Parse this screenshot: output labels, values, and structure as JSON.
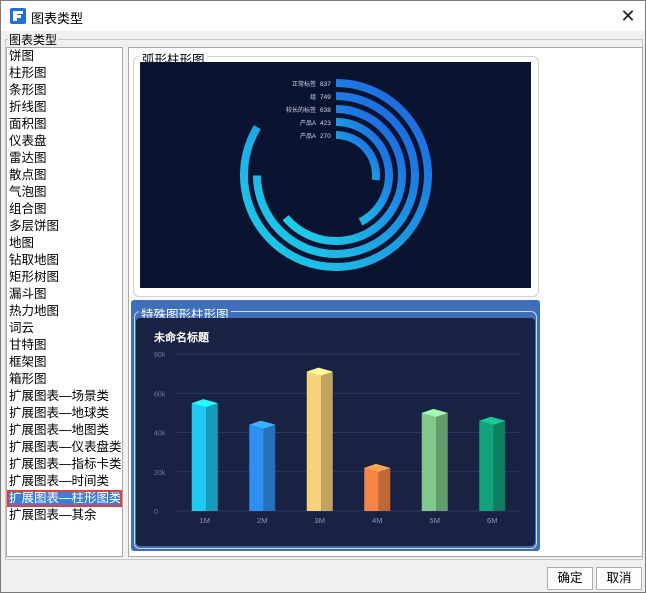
{
  "window": {
    "title": "图表类型",
    "close_glyph": "✕"
  },
  "group": {
    "legend": "图表类型"
  },
  "chart_types": [
    "饼图",
    "柱形图",
    "条形图",
    "折线图",
    "面积图",
    "仪表盘",
    "雷达图",
    "散点图",
    "气泡图",
    "组合图",
    "多层饼图",
    "地图",
    "钻取地图",
    "矩形树图",
    "漏斗图",
    "热力地图",
    "词云",
    "甘特图",
    "框架图",
    "箱形图",
    "扩展图表—场景类",
    "扩展图表—地球类",
    "扩展图表—地图类",
    "扩展图表—仪表盘类",
    "扩展图表—指标卡类",
    "扩展图表—时间类",
    "扩展图表—柱形图类",
    "扩展图表—其余"
  ],
  "selected_index": 26,
  "previews": [
    {
      "name": "弧形柱形图"
    },
    {
      "name": "特殊图形柱形图"
    }
  ],
  "chart_data": [
    {
      "type": "bar",
      "subtype": "radial-arc",
      "categories": [
        "正常标签",
        "组",
        "较长的标签",
        "产品A",
        "产品A"
      ],
      "values": [
        837,
        749,
        638,
        423,
        270
      ],
      "colors": {
        "background": "#0a1430",
        "gradient_start": "#1dd6e8",
        "gradient_end": "#1f5ee0"
      }
    },
    {
      "type": "bar",
      "subtype": "3d-column",
      "title": "未命名标题",
      "categories": [
        "1M",
        "2M",
        "3M",
        "4M",
        "5M",
        "6M"
      ],
      "values": [
        55000,
        44000,
        71000,
        22000,
        50000,
        46000
      ],
      "ylim": [
        0,
        80000
      ],
      "yticks": [
        "0",
        "20k",
        "40k",
        "60k",
        "80k"
      ],
      "colors": [
        "#1ec8f0",
        "#2d8ff0",
        "#f7d27a",
        "#f58447",
        "#7fc98a",
        "#12a27a"
      ],
      "background": "#1a2243",
      "grid": true
    }
  ],
  "buttons": {
    "ok": "确定",
    "cancel": "取消"
  }
}
